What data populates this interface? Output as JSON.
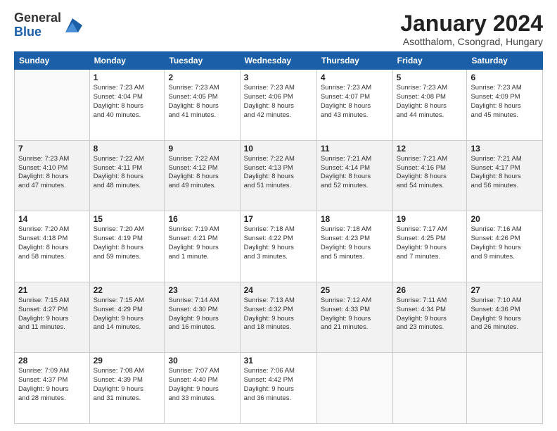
{
  "header": {
    "logo_general": "General",
    "logo_blue": "Blue",
    "month_title": "January 2024",
    "location": "Asotthalom, Csongrad, Hungary"
  },
  "days_of_week": [
    "Sunday",
    "Monday",
    "Tuesday",
    "Wednesday",
    "Thursday",
    "Friday",
    "Saturday"
  ],
  "weeks": [
    {
      "alt": false,
      "days": [
        {
          "num": "",
          "info": ""
        },
        {
          "num": "1",
          "info": "Sunrise: 7:23 AM\nSunset: 4:04 PM\nDaylight: 8 hours\nand 40 minutes."
        },
        {
          "num": "2",
          "info": "Sunrise: 7:23 AM\nSunset: 4:05 PM\nDaylight: 8 hours\nand 41 minutes."
        },
        {
          "num": "3",
          "info": "Sunrise: 7:23 AM\nSunset: 4:06 PM\nDaylight: 8 hours\nand 42 minutes."
        },
        {
          "num": "4",
          "info": "Sunrise: 7:23 AM\nSunset: 4:07 PM\nDaylight: 8 hours\nand 43 minutes."
        },
        {
          "num": "5",
          "info": "Sunrise: 7:23 AM\nSunset: 4:08 PM\nDaylight: 8 hours\nand 44 minutes."
        },
        {
          "num": "6",
          "info": "Sunrise: 7:23 AM\nSunset: 4:09 PM\nDaylight: 8 hours\nand 45 minutes."
        }
      ]
    },
    {
      "alt": true,
      "days": [
        {
          "num": "7",
          "info": "Sunrise: 7:23 AM\nSunset: 4:10 PM\nDaylight: 8 hours\nand 47 minutes."
        },
        {
          "num": "8",
          "info": "Sunrise: 7:22 AM\nSunset: 4:11 PM\nDaylight: 8 hours\nand 48 minutes."
        },
        {
          "num": "9",
          "info": "Sunrise: 7:22 AM\nSunset: 4:12 PM\nDaylight: 8 hours\nand 49 minutes."
        },
        {
          "num": "10",
          "info": "Sunrise: 7:22 AM\nSunset: 4:13 PM\nDaylight: 8 hours\nand 51 minutes."
        },
        {
          "num": "11",
          "info": "Sunrise: 7:21 AM\nSunset: 4:14 PM\nDaylight: 8 hours\nand 52 minutes."
        },
        {
          "num": "12",
          "info": "Sunrise: 7:21 AM\nSunset: 4:16 PM\nDaylight: 8 hours\nand 54 minutes."
        },
        {
          "num": "13",
          "info": "Sunrise: 7:21 AM\nSunset: 4:17 PM\nDaylight: 8 hours\nand 56 minutes."
        }
      ]
    },
    {
      "alt": false,
      "days": [
        {
          "num": "14",
          "info": "Sunrise: 7:20 AM\nSunset: 4:18 PM\nDaylight: 8 hours\nand 58 minutes."
        },
        {
          "num": "15",
          "info": "Sunrise: 7:20 AM\nSunset: 4:19 PM\nDaylight: 8 hours\nand 59 minutes."
        },
        {
          "num": "16",
          "info": "Sunrise: 7:19 AM\nSunset: 4:21 PM\nDaylight: 9 hours\nand 1 minute."
        },
        {
          "num": "17",
          "info": "Sunrise: 7:18 AM\nSunset: 4:22 PM\nDaylight: 9 hours\nand 3 minutes."
        },
        {
          "num": "18",
          "info": "Sunrise: 7:18 AM\nSunset: 4:23 PM\nDaylight: 9 hours\nand 5 minutes."
        },
        {
          "num": "19",
          "info": "Sunrise: 7:17 AM\nSunset: 4:25 PM\nDaylight: 9 hours\nand 7 minutes."
        },
        {
          "num": "20",
          "info": "Sunrise: 7:16 AM\nSunset: 4:26 PM\nDaylight: 9 hours\nand 9 minutes."
        }
      ]
    },
    {
      "alt": true,
      "days": [
        {
          "num": "21",
          "info": "Sunrise: 7:15 AM\nSunset: 4:27 PM\nDaylight: 9 hours\nand 11 minutes."
        },
        {
          "num": "22",
          "info": "Sunrise: 7:15 AM\nSunset: 4:29 PM\nDaylight: 9 hours\nand 14 minutes."
        },
        {
          "num": "23",
          "info": "Sunrise: 7:14 AM\nSunset: 4:30 PM\nDaylight: 9 hours\nand 16 minutes."
        },
        {
          "num": "24",
          "info": "Sunrise: 7:13 AM\nSunset: 4:32 PM\nDaylight: 9 hours\nand 18 minutes."
        },
        {
          "num": "25",
          "info": "Sunrise: 7:12 AM\nSunset: 4:33 PM\nDaylight: 9 hours\nand 21 minutes."
        },
        {
          "num": "26",
          "info": "Sunrise: 7:11 AM\nSunset: 4:34 PM\nDaylight: 9 hours\nand 23 minutes."
        },
        {
          "num": "27",
          "info": "Sunrise: 7:10 AM\nSunset: 4:36 PM\nDaylight: 9 hours\nand 26 minutes."
        }
      ]
    },
    {
      "alt": false,
      "days": [
        {
          "num": "28",
          "info": "Sunrise: 7:09 AM\nSunset: 4:37 PM\nDaylight: 9 hours\nand 28 minutes."
        },
        {
          "num": "29",
          "info": "Sunrise: 7:08 AM\nSunset: 4:39 PM\nDaylight: 9 hours\nand 31 minutes."
        },
        {
          "num": "30",
          "info": "Sunrise: 7:07 AM\nSunset: 4:40 PM\nDaylight: 9 hours\nand 33 minutes."
        },
        {
          "num": "31",
          "info": "Sunrise: 7:06 AM\nSunset: 4:42 PM\nDaylight: 9 hours\nand 36 minutes."
        },
        {
          "num": "",
          "info": ""
        },
        {
          "num": "",
          "info": ""
        },
        {
          "num": "",
          "info": ""
        }
      ]
    }
  ]
}
